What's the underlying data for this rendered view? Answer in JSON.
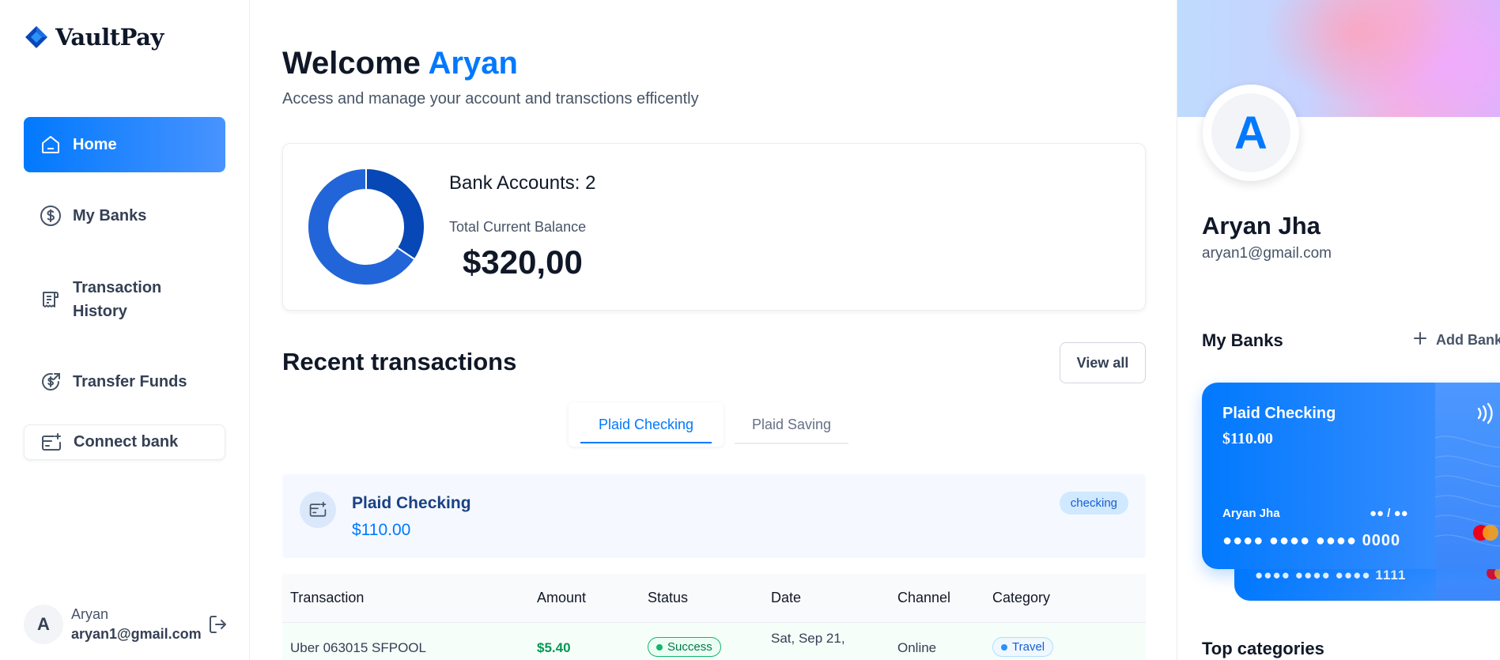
{
  "app": {
    "name": "VaultPay"
  },
  "sidebar": {
    "items": [
      {
        "label": "Home"
      },
      {
        "label": "My Banks"
      },
      {
        "label": "Transaction History"
      },
      {
        "label": "Transfer Funds"
      },
      {
        "label": "Connect bank"
      }
    ],
    "footer": {
      "initial": "A",
      "name": "Aryan",
      "email": "aryan1@gmail.com"
    }
  },
  "header": {
    "greeting": "Welcome",
    "user": "Aryan",
    "subtitle": "Access and manage your account and transctions efficently"
  },
  "balance": {
    "bank_accounts_label": "Bank Accounts: 2",
    "total_label": "Total Current Balance",
    "total_value": "$320,00",
    "donut": [
      {
        "name": "Plaid Checking",
        "value": 110,
        "color": "#0747b6"
      },
      {
        "name": "Plaid Saving",
        "value": 210,
        "color": "#2265d8"
      }
    ]
  },
  "recent": {
    "title": "Recent transactions",
    "view_all": "View all",
    "tabs": [
      {
        "label": "Plaid Checking",
        "active": true
      },
      {
        "label": "Plaid Saving",
        "active": false
      }
    ],
    "account": {
      "name": "Plaid Checking",
      "balance": "$110.00",
      "badge": "checking"
    },
    "columns": [
      "Transaction",
      "Amount",
      "Status",
      "Date",
      "Channel",
      "Category"
    ],
    "rows": [
      {
        "name": "Uber 063015 SFPOOL",
        "amount": "$5.40",
        "status": "Success",
        "date": "Sat, Sep 21,",
        "channel": "Online",
        "category": "Travel"
      }
    ]
  },
  "profile": {
    "initial": "A",
    "name": "Aryan Jha",
    "email": "aryan1@gmail.com",
    "my_banks_title": "My Banks",
    "add_bank": "Add Bank",
    "top_categories_title": "Top categories"
  },
  "cards": {
    "front": {
      "name": "Plaid Checking",
      "balance": "$110.00",
      "holder": "Aryan Jha",
      "expiry": "●● / ●●",
      "number": "●●●● ●●●● ●●●● 0000"
    },
    "back": {
      "number": "●●●● ●●●● ●●●● 1111"
    }
  },
  "colors": {
    "accent": "#0179fe",
    "success": "#12b76a"
  }
}
